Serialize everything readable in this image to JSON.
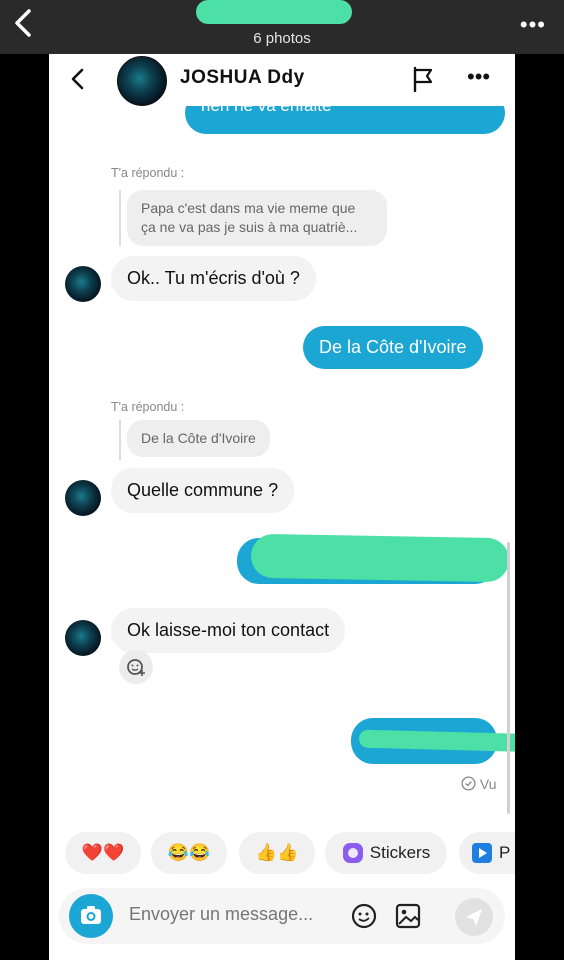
{
  "outer": {
    "photos_count": "6 photos",
    "more_label": "•••"
  },
  "header": {
    "name": "JOSHUA  Ddy",
    "more_label": "•••"
  },
  "messages": {
    "out_top": "rien ne va enfaite",
    "reply1_label": "T'a répondu :",
    "reply1_quote_line1": "Papa c'est dans ma vie meme que",
    "reply1_quote_line2": "ça ne va pas je suis à ma quatriè...",
    "in1": "Ok.. Tu m'écris d'où ?",
    "out1": "De la Côte d'Ivoire",
    "reply2_label": "T'a répondu :",
    "reply2_quote": "De la Côte d'Ivoire",
    "in2": "Quelle commune ?",
    "in3": "Ok laisse-moi ton contact",
    "seen": "Vu"
  },
  "chips": [
    {
      "label": "❤️❤️"
    },
    {
      "label": "😂😂"
    },
    {
      "label": "👍👍"
    },
    {
      "label": "Stickers"
    },
    {
      "label": "P"
    }
  ],
  "composer": {
    "placeholder": "Envoyer un message..."
  },
  "colors": {
    "accent": "#1ba6d4",
    "redaction": "#4de0a6"
  }
}
